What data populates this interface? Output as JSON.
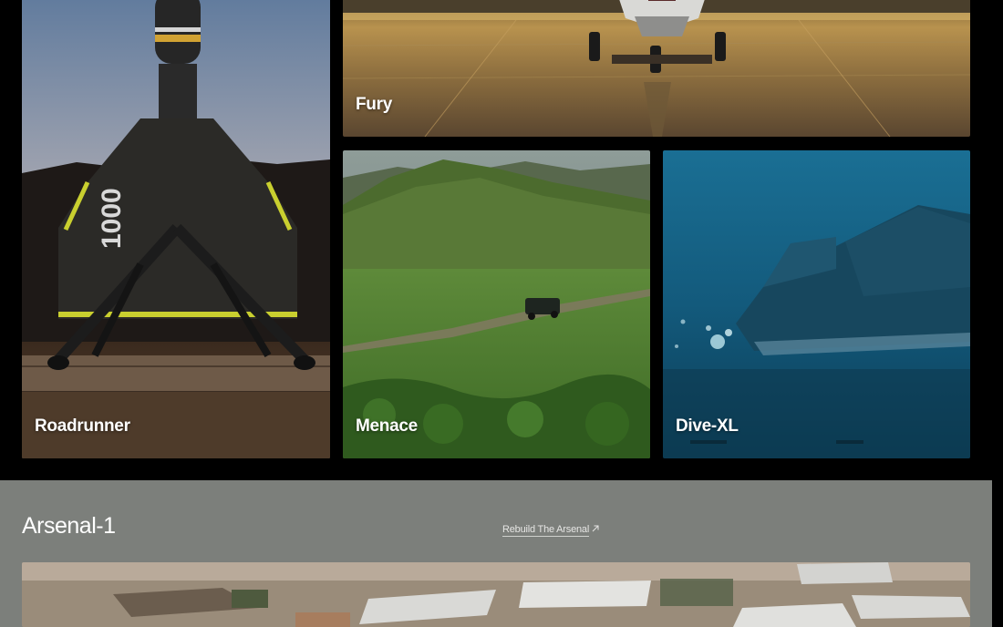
{
  "products": {
    "fury": {
      "label": "Fury"
    },
    "roadrunner": {
      "label": "Roadrunner"
    },
    "menace": {
      "label": "Menace"
    },
    "dive_xl": {
      "label": "Dive-XL"
    }
  },
  "arsenal": {
    "title": "Arsenal-1",
    "link_label": "Rebuild The Arsenal",
    "link_icon": "arrow-up-right-icon"
  },
  "colors": {
    "page_background": "#000000",
    "arsenal_background": "#7c7f7b",
    "label_text": "#ffffff"
  }
}
